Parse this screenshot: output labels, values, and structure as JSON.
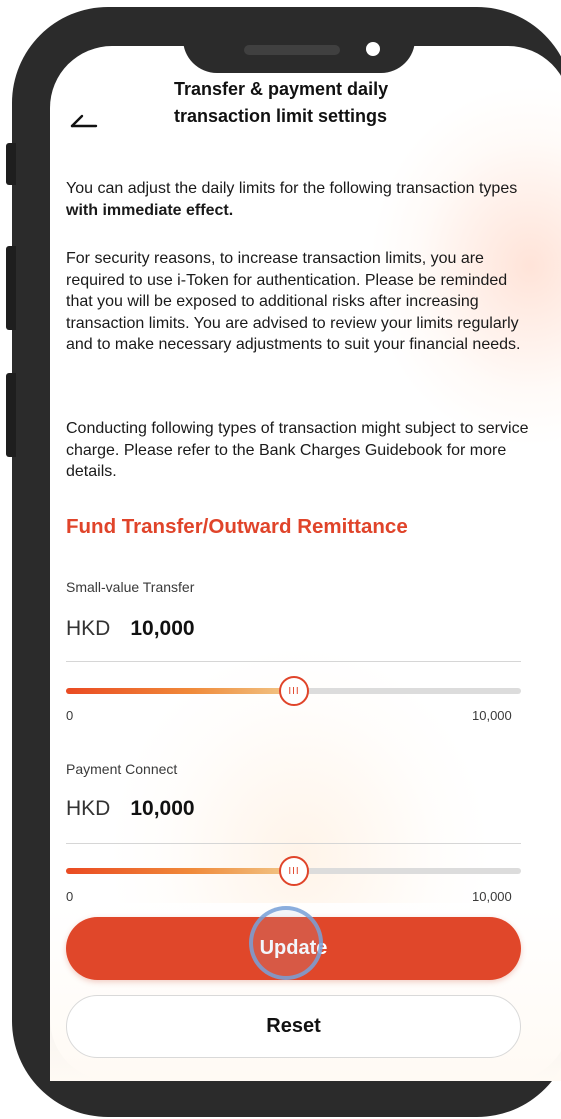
{
  "header": {
    "title_line1": "Transfer & payment daily",
    "title_line2": "transaction limit settings"
  },
  "intro": {
    "p1_text": "You can adjust the daily limits for the following transaction types ",
    "p1_bold": "with immediate effect.",
    "p2": "For security reasons, to increase transaction limits, you are required to use i-Token for authentication. Please be reminded that you will be exposed to additional risks after increasing transaction limits. You are advised to review your limits regularly and to make necessary adjustments to suit your financial needs.",
    "p3": "Conducting following types of transaction might subject to service charge. Please refer to the Bank Charges Guidebook for more details."
  },
  "section": {
    "title": "Fund Transfer/Outward Remittance"
  },
  "limits": [
    {
      "label": "Small-value Transfer",
      "currency": "HKD",
      "amount": "10,000",
      "min_label": "0",
      "max_label": "10,000",
      "slider_fraction": 0.5,
      "thumb_glyph": "III"
    },
    {
      "label": "Payment Connect",
      "currency": "HKD",
      "amount": "10,000",
      "min_label": "0",
      "max_label": "10,000",
      "slider_fraction": 0.5,
      "thumb_glyph": "III"
    }
  ],
  "actions": {
    "update_label": "Update",
    "reset_label": "Reset"
  },
  "colors": {
    "accent": "#e0442a",
    "frame": "#2b2b2b"
  },
  "icons": {
    "back": "back-arrow-icon"
  }
}
